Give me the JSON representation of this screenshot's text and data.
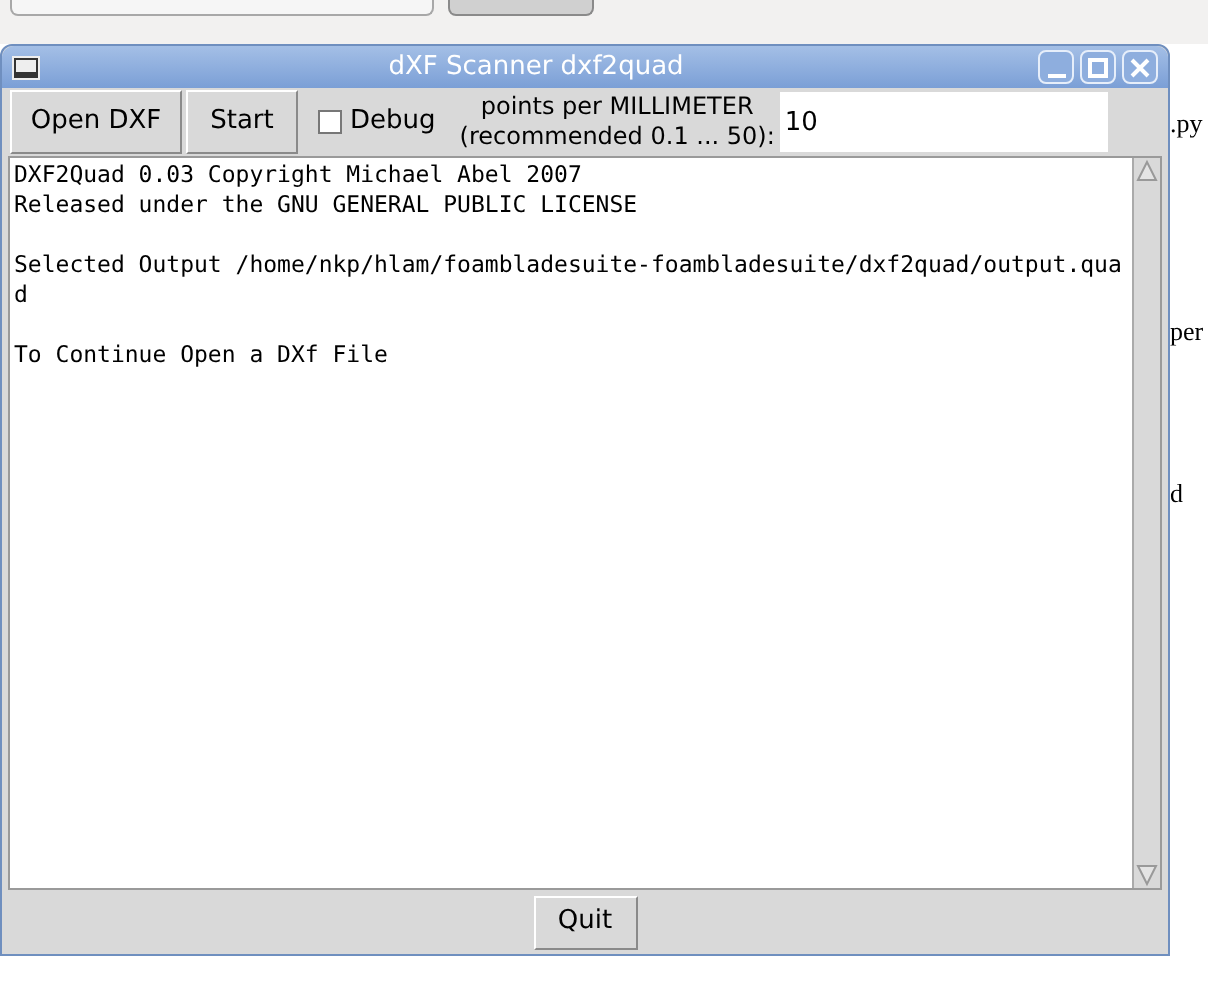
{
  "background": {
    "fragments": [
      ".py",
      "per",
      "d"
    ]
  },
  "window": {
    "title": "dXF Scanner dxf2quad"
  },
  "toolbar": {
    "buttons": [
      "Open DXF",
      "Start"
    ],
    "debug": {
      "label": "Debug",
      "checked": false
    },
    "points_label": "points per MILLIMETER\n(recommended 0.1 ... 50):",
    "points_value": "10"
  },
  "output": {
    "paragraphs": [
      {
        "lines": [
          "DXF2Quad 0.03 Copyright Michael Abel 2007",
          "Released under the GNU GENERAL PUBLIC LICENSE"
        ]
      },
      {
        "lines": [
          "Selected Output /home/nkp/hlam/foambladesuite-foambladesuite/dxf2quad/output.qua",
          "d"
        ]
      },
      {
        "lines": [
          "To Continue Open a DXf File"
        ]
      }
    ]
  },
  "footer": {
    "button": "Quit"
  }
}
